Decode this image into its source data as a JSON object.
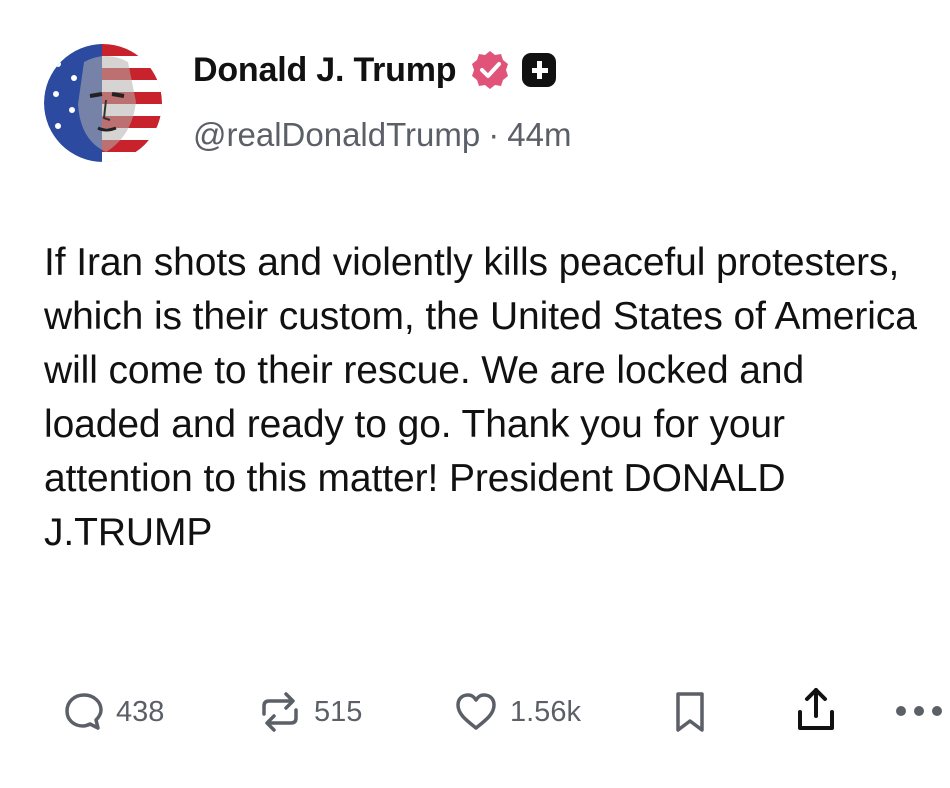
{
  "post": {
    "author": {
      "display_name": "Donald J. Trump",
      "handle": "@realDonaldTrump",
      "separator": "·",
      "time_ago": "44m",
      "verified_color": "#e0547a"
    },
    "text": "If Iran shots and violently kills peaceful protesters, which is their custom, the United States of America will come to their rescue. We are locked and loaded and ready to go. Thank you for your attention to this matter! President DONALD J.TRUMP",
    "actions": {
      "reply_count": "438",
      "repost_count": "515",
      "like_count": "1.56k"
    }
  },
  "icons": [
    "avatar-image",
    "verified-icon",
    "plus-badge-icon",
    "reply-icon",
    "repost-icon",
    "heart-icon",
    "bookmark-icon",
    "share-icon",
    "more-icon"
  ]
}
